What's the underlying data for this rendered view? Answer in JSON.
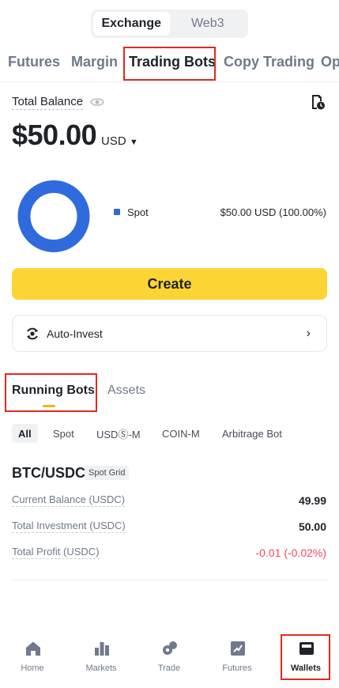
{
  "segment": {
    "options": [
      "Exchange",
      "Web3"
    ],
    "active": "Exchange"
  },
  "tabs": [
    "Futures",
    "Margin",
    "Trading Bots",
    "Copy Trading",
    "Op"
  ],
  "active_tab": "Trading Bots",
  "balance": {
    "label": "Total Balance",
    "amount": "$50.00",
    "currency": "USD"
  },
  "allocation": {
    "label": "Spot",
    "value": "$50.00 USD (100.00%)",
    "color": "#2f6bdd",
    "percent": 100
  },
  "create_label": "Create",
  "auto_invest": {
    "label": "Auto-Invest"
  },
  "sub_tabs": [
    "Running Bots",
    "Assets"
  ],
  "active_sub_tab": "Running Bots",
  "filters": [
    "All",
    "Spot",
    "USDⓈ-M",
    "COIN-M",
    "Arbitrage Bot"
  ],
  "bot": {
    "pair": "BTC/USDC",
    "type": "Spot Grid",
    "rows": [
      {
        "label": "Current Balance (USDC)",
        "value": "49.99"
      },
      {
        "label": "Total Investment (USDC)",
        "value": "50.00"
      },
      {
        "label": "Total Profit (USDC)",
        "value": "-0.01 (-0.02%)"
      }
    ]
  },
  "nav": [
    "Home",
    "Markets",
    "Trade",
    "Futures",
    "Wallets"
  ],
  "active_nav": "Wallets",
  "colors": {
    "accent": "#fcd535",
    "negative": "#f6465d",
    "highlight": "#e02b1d"
  }
}
